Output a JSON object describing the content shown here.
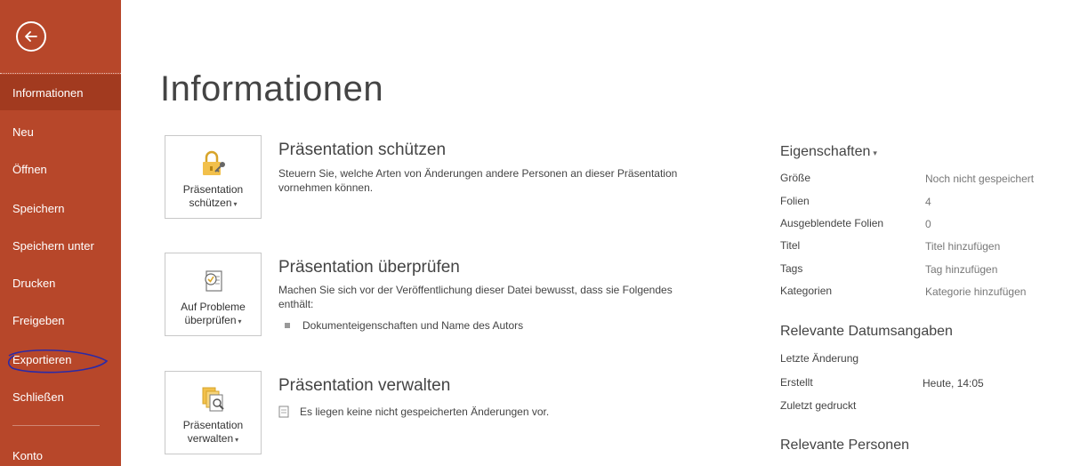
{
  "sidebar": {
    "items": [
      {
        "label": "Informationen",
        "active": true
      },
      {
        "label": "Neu"
      },
      {
        "label": "Öffnen"
      },
      {
        "label": "Speichern"
      },
      {
        "label": "Speichern unter"
      },
      {
        "label": "Drucken"
      },
      {
        "label": "Freigeben"
      },
      {
        "label": "Exportieren"
      },
      {
        "label": "Schließen"
      },
      {
        "label": "Konto"
      }
    ]
  },
  "main": {
    "title": "Informationen",
    "sections": [
      {
        "button_line1": "Präsentation",
        "button_line2": "schützen",
        "title": "Präsentation schützen",
        "description": "Steuern Sie, welche Arten von Änderungen andere Personen an dieser Präsentation vornehmen können."
      },
      {
        "button_line1": "Auf Probleme",
        "button_line2": "überprüfen",
        "title": "Präsentation überprüfen",
        "description": "Machen Sie sich vor der Veröffentlichung dieser Datei bewusst, dass sie Folgendes enthält:",
        "bullets": [
          "Dokumenteigenschaften und Name des Autors"
        ]
      },
      {
        "button_line1": "Präsentation",
        "button_line2": "verwalten",
        "title": "Präsentation verwalten",
        "note": "Es liegen keine nicht gespeicherten Änderungen vor."
      }
    ]
  },
  "properties": {
    "heading": "Eigenschaften",
    "rows": [
      {
        "label": "Größe",
        "value": "Noch nicht gespeichert"
      },
      {
        "label": "Folien",
        "value": "4"
      },
      {
        "label": "Ausgeblendete Folien",
        "value": "0"
      },
      {
        "label": "Titel",
        "value": "Titel hinzufügen"
      },
      {
        "label": "Tags",
        "value": "Tag hinzufügen"
      },
      {
        "label": "Kategorien",
        "value": "Kategorie hinzufügen"
      }
    ],
    "dates_heading": "Relevante Datumsangaben",
    "dates": [
      {
        "label": "Letzte Änderung",
        "value": ""
      },
      {
        "label": "Erstellt",
        "value": "Heute, 14:05"
      },
      {
        "label": "Zuletzt gedruckt",
        "value": ""
      }
    ],
    "people_heading": "Relevante Personen"
  },
  "colors": {
    "sidebar_bg": "#b7472a",
    "sidebar_active": "#a23a1f",
    "annotation": "#2a2aa8"
  }
}
